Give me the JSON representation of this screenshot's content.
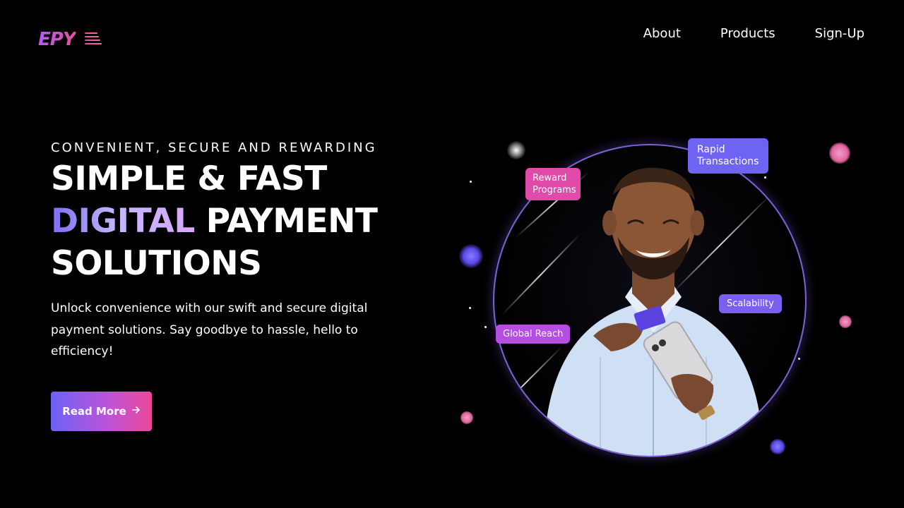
{
  "brand": {
    "logo_text": "EPY"
  },
  "nav": {
    "items": [
      {
        "label": "About"
      },
      {
        "label": "Products"
      },
      {
        "label": "Sign-Up"
      }
    ]
  },
  "hero": {
    "eyebrow": "CONVENIENT, SECURE AND REWARDING",
    "headline": {
      "line1": "SIMPLE & FAST",
      "line2_highlight": "DIGITAL",
      "line2_rest": " PAYMENT",
      "line3": "SOLUTIONS"
    },
    "description": "Unlock convenience with our swift and secure digital payment solutions. Say goodbye to hassle, hello to efficiency!",
    "cta_label": "Read More",
    "cta_icon": "arrow-right-icon"
  },
  "illustration": {
    "badges": [
      {
        "label": "Reward Programs"
      },
      {
        "label": "Rapid Transactions"
      },
      {
        "label": "Scalability"
      },
      {
        "label": "Global Reach"
      }
    ]
  },
  "colors": {
    "background": "#000000",
    "accent_purple": "#6f63f3",
    "accent_pink": "#e04aa8",
    "text": "#ffffff"
  }
}
